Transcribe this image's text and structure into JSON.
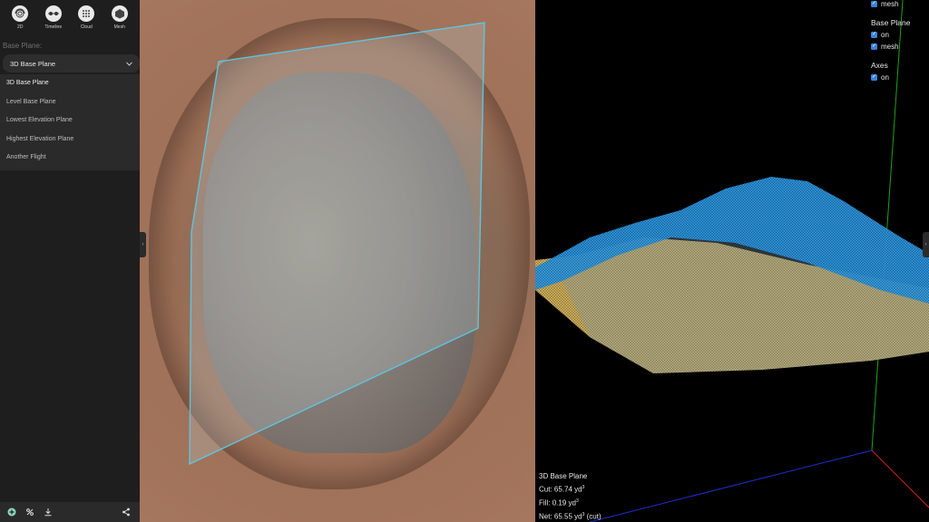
{
  "sidebar": {
    "top_icons": [
      {
        "label": "2D",
        "icon": "fingerprint-icon"
      },
      {
        "label": "Timeline",
        "icon": "timeline-icon"
      },
      {
        "label": "Cloud",
        "icon": "cloud-icon"
      },
      {
        "label": "Mesh",
        "icon": "mesh-icon"
      }
    ],
    "base_plane_label": "Base Plane:",
    "select_value": "3D Base Plane",
    "options": [
      "3D Base Plane",
      "Level Base Plane",
      "Lowest Elevation Plane",
      "Highest Elevation Plane",
      "Another Flight"
    ],
    "bottom_icons": [
      "add-icon",
      "flight-icon",
      "download-icon",
      "share-icon"
    ]
  },
  "view3d": {
    "toggles": {
      "top_item": "mesh",
      "base_plane_title": "Base Plane",
      "base_plane_items": [
        "on",
        "mesh"
      ],
      "axes_title": "Axes",
      "axes_items": [
        "on"
      ]
    },
    "stats": {
      "title": "3D Base Plane",
      "cut_label": "Cut:",
      "cut_value": "65.74 yd",
      "fill_label": "Fill:",
      "fill_value": "0.19 yd",
      "net_label": "Net:",
      "net_value": "65.55 yd",
      "net_suffix": "(cut)",
      "unit_exp": "3"
    },
    "colors": {
      "mesh_top": "#2e9be0",
      "mesh_base": "#e8c46a",
      "axis_y": "#1aa51a",
      "axis_x": "#d42020",
      "axis_z": "#1f2fd0"
    }
  },
  "map": {
    "polygon_color": "#5fc4e0"
  }
}
